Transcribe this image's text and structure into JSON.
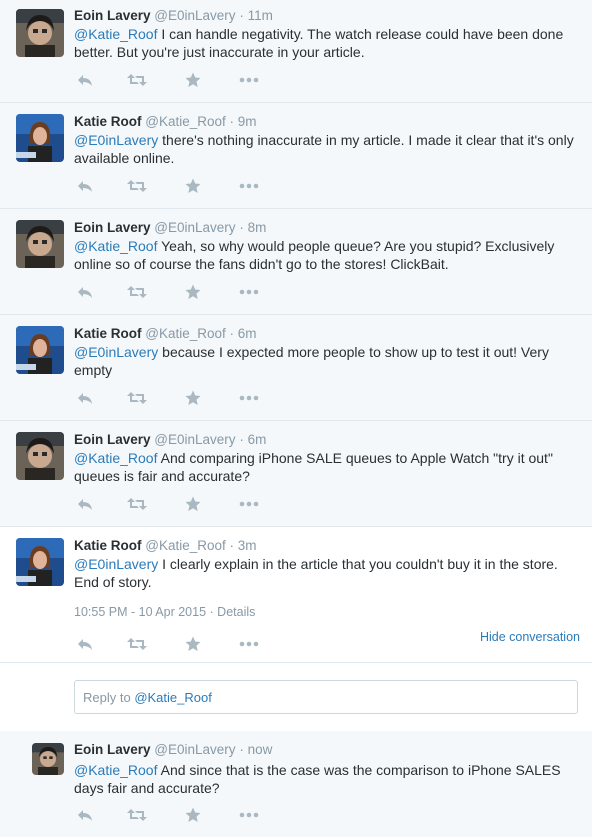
{
  "colors": {
    "link": "#2b7bb9",
    "muted": "#8899a6",
    "text": "#292f33",
    "bg": "#f5f8fa"
  },
  "icons": [
    "reply-icon",
    "retweet-icon",
    "favorite-icon",
    "more-icon"
  ],
  "tweets": [
    {
      "name": "Eoin Lavery",
      "handle": "@E0inLavery",
      "time": "11m",
      "mention": "@Katie_Roof",
      "text_line1": " I can handle negativity. The watch release could have been done",
      "text_line2": "better. But you're just inaccurate in your article."
    },
    {
      "name": "Katie Roof",
      "handle": "@Katie_Roof",
      "time": "9m",
      "mention": "@E0inLavery",
      "text_line1": " there's nothing inaccurate in my article. I made it clear that it's only",
      "text_line2": "available online."
    },
    {
      "name": "Eoin Lavery",
      "handle": "@E0inLavery",
      "time": "8m",
      "mention": "@Katie_Roof",
      "text_line1": " Yeah, so why would people queue? Are you stupid? Exclusively",
      "text_line2": "online so of course the fans didn't go to the stores! ClickBait."
    },
    {
      "name": "Katie Roof",
      "handle": "@Katie_Roof",
      "time": "6m",
      "mention": "@E0inLavery",
      "text_line1": " because I expected more people to show up to test it out! Very",
      "text_line2": "empty"
    },
    {
      "name": "Eoin Lavery",
      "handle": "@E0inLavery",
      "time": "6m",
      "mention": "@Katie_Roof",
      "text_line1": " And comparing iPhone SALE queues to Apple Watch \"try it out\"",
      "text_line2": "queues is fair and accurate?"
    },
    {
      "name": "Katie Roof",
      "handle": "@Katie_Roof",
      "time": "3m",
      "mention": "@E0inLavery",
      "text_line1": " I clearly explain in the article that you couldn't buy it in the store.",
      "text_line2": "End of story.",
      "timestamp": "10:55 PM - 10 Apr 2015",
      "details": "Details",
      "hide_conversation": "Hide conversation"
    }
  ],
  "reply": {
    "prefix": "Reply to ",
    "mention": "@Katie_Roof"
  },
  "reply_tweet": {
    "name": "Eoin Lavery",
    "handle": "@E0inLavery",
    "time": "now",
    "mention": "@Katie_Roof",
    "text_line1": " And since that is the case was the comparison to iPhone SALES",
    "text_line2": "days fair and accurate?"
  }
}
